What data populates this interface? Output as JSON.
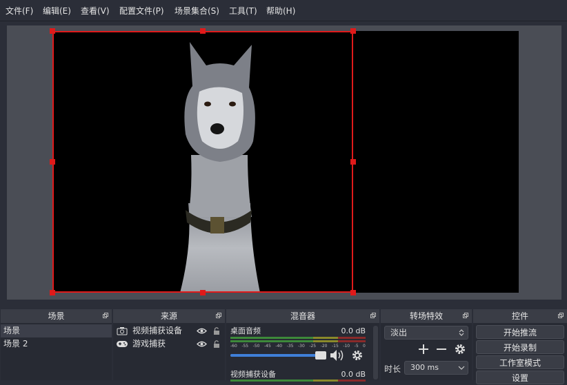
{
  "menu": [
    "文件(F)",
    "编辑(E)",
    "查看(V)",
    "配置文件(P)",
    "场景集合(S)",
    "工具(T)",
    "帮助(H)"
  ],
  "docks": {
    "scenes": {
      "title": "场景",
      "items": [
        "场景",
        "场景 2"
      ]
    },
    "sources": {
      "title": "来源",
      "items": [
        {
          "label": "视频捕获设备",
          "icon": "camera-icon"
        },
        {
          "label": "游戏捕获",
          "icon": "gamepad-icon"
        }
      ]
    },
    "mixer": {
      "title": "混音器",
      "channels": [
        {
          "name": "桌面音频",
          "db": "0.0 dB",
          "volume": 0.95
        },
        {
          "name": "视频捕获设备",
          "db": "0.0 dB"
        }
      ],
      "scale": [
        "-60",
        "-55",
        "-50",
        "-45",
        "-40",
        "-35",
        "-30",
        "-25",
        "-20",
        "-15",
        "-10",
        "-5",
        "0"
      ]
    },
    "transitions": {
      "title": "转场特效",
      "selected": "淡出",
      "duration_label": "时长",
      "duration_value": "300 ms"
    },
    "controls": {
      "title": "控件",
      "buttons": [
        "开始推流",
        "开始录制",
        "工作室模式",
        "设置"
      ]
    }
  },
  "colors": {
    "selection": "#e01a1a",
    "accent": "#3f7fd8"
  }
}
